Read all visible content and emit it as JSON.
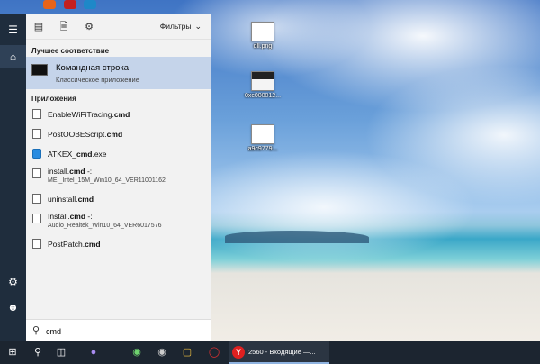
{
  "toolbar": {
    "filters_label": "Фильтры"
  },
  "best_match": {
    "heading": "Лучшее соответствие",
    "title": "Командная строка",
    "subtitle": "Классическое приложение"
  },
  "apps": {
    "heading": "Приложения",
    "items": [
      {
        "name_pre": "EnableWiFiTracing.",
        "name_bold": "cmd",
        "sub": ""
      },
      {
        "name_pre": "PostOOBEScript.",
        "name_bold": "cmd",
        "sub": ""
      },
      {
        "name_pre": "ATKEX_",
        "name_bold": "cmd",
        "name_post": ".exe",
        "sub": ""
      },
      {
        "name_pre": "install.",
        "name_bold": "cmd",
        "name_post": " -:",
        "sub": "MEI_Intel_15M_Win10_64_VER11001162"
      },
      {
        "name_pre": "uninstall.",
        "name_bold": "cmd",
        "sub": ""
      },
      {
        "name_pre": "Install.",
        "name_bold": "cmd",
        "name_post": " -:",
        "sub": "Audio_Realtek_Win10_64_VER6017576"
      },
      {
        "name_pre": "PostPatch.",
        "name_bold": "cmd",
        "sub": ""
      }
    ]
  },
  "search": {
    "value": "cmd"
  },
  "desktop": {
    "icons": [
      {
        "label": "dll.png"
      },
      {
        "label": "0xc000012..."
      },
      {
        "label": "a9c9779..."
      }
    ]
  },
  "taskbar": {
    "window_title": "2560 - Входящие —..."
  }
}
